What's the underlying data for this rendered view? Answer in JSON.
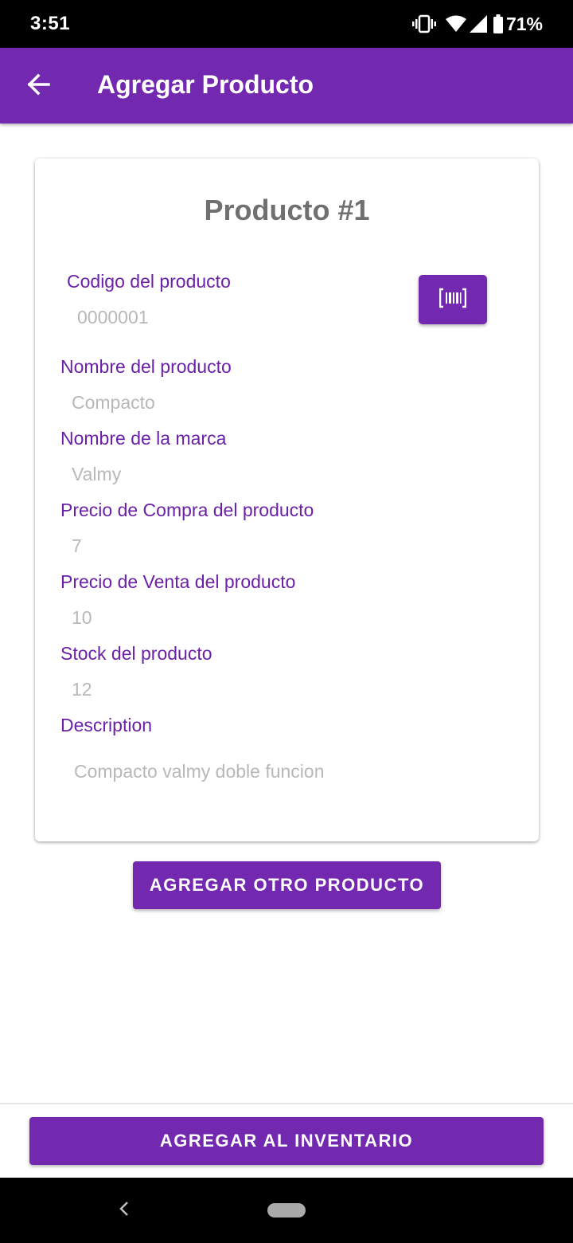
{
  "status_bar": {
    "time": "3:51",
    "battery": "71%",
    "icons": [
      "vibrate-icon",
      "wifi-icon",
      "signal-icon",
      "battery-icon"
    ]
  },
  "app_bar": {
    "title": "Agregar Producto",
    "back_icon": "arrow-back-icon"
  },
  "card": {
    "title": "Producto #1",
    "fields": [
      {
        "label": "Codigo del producto",
        "value": "0000001"
      },
      {
        "label": "Nombre del producto",
        "value": "Compacto"
      },
      {
        "label": "Nombre de la marca",
        "value": "Valmy"
      },
      {
        "label": "Precio de Compra del producto",
        "value": "7"
      },
      {
        "label": "Precio de Venta del producto",
        "value": "10"
      },
      {
        "label": "Stock del producto",
        "value": "12"
      },
      {
        "label": "Description",
        "value": "Compacto valmy doble funcion"
      }
    ],
    "scan_icon": "barcode-scan-icon"
  },
  "buttons": {
    "add_another": "AGREGAR OTRO PRODUCTO",
    "add_inventory": "AGREGAR AL INVENTARIO"
  },
  "colors": {
    "primary": "#7328b0",
    "label": "#6a20a8",
    "value": "#b8b8b8",
    "title": "#707070"
  }
}
